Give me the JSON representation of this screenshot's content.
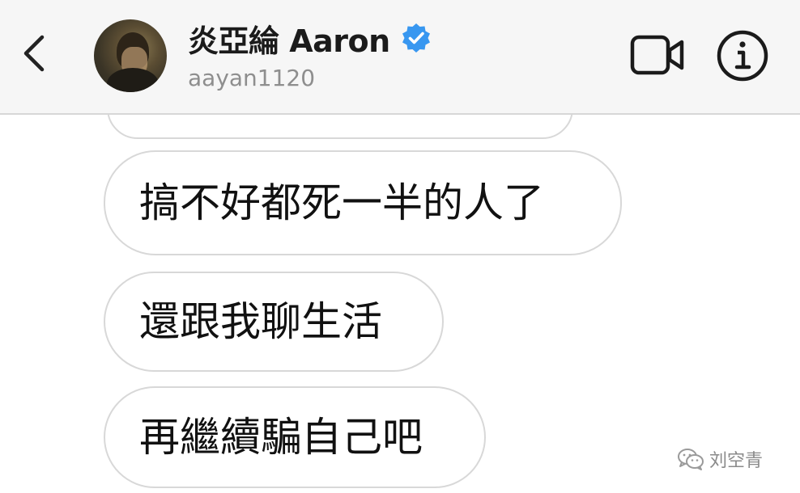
{
  "header": {
    "display_name": "炎亞綸 Aaron",
    "username": "aayan1120",
    "icons": {
      "back": "chevron-left-icon",
      "verified": "verified-badge-icon",
      "video": "video-call-icon",
      "info": "info-icon"
    },
    "colors": {
      "verified": "#3897f0",
      "header_bg": "#f6f6f6"
    }
  },
  "messages": [
    {
      "text": ""
    },
    {
      "text": "搞不好都死一半的人了"
    },
    {
      "text": "還跟我聊生活"
    },
    {
      "text": "再繼續騙自己吧"
    }
  ],
  "watermark": {
    "text": "刘空青",
    "icon": "wechat-icon"
  }
}
